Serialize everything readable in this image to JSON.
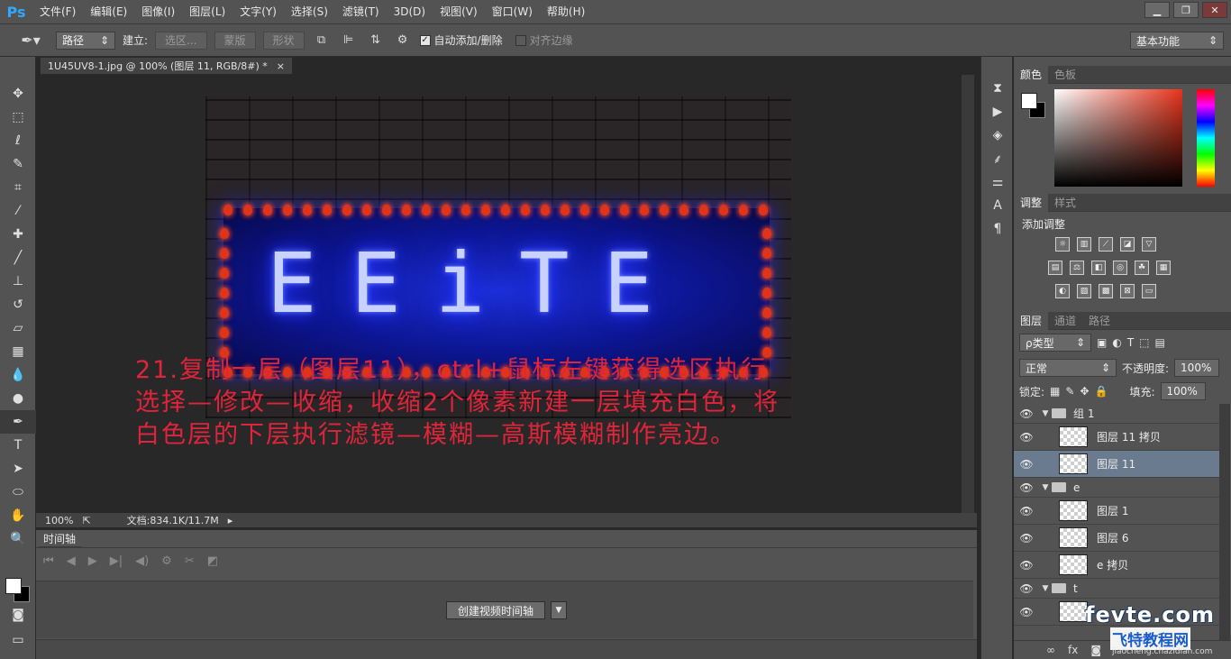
{
  "app": {
    "logo": "Ps",
    "menu": [
      "文件(F)",
      "编辑(E)",
      "图像(I)",
      "图层(L)",
      "文字(Y)",
      "选择(S)",
      "滤镜(T)",
      "3D(D)",
      "视图(V)",
      "窗口(W)",
      "帮助(H)"
    ],
    "window_buttons": [
      "▁",
      "❐",
      "✕"
    ]
  },
  "options": {
    "mode_select": "路径",
    "build_label": "建立:",
    "btn_selection": "选区...",
    "btn_mask": "蒙版",
    "btn_shape": "形状",
    "auto_add_delete": "自动添加/删除",
    "align_edges": "对齐边缘",
    "workspace": "基本功能"
  },
  "document": {
    "tab_title": "1U45UV8-1.jpg @ 100% (图层 11, RGB/8#) *",
    "tab_close": "×",
    "zoom": "100%",
    "doc_size": "文档:834.1K/11.7M",
    "neon_text": "EEiTE",
    "overlay_lines": [
      "21.复制一层（图层11），ctrl+鼠标左键获得选区执行",
      "选择—修改—收缩，收缩2个像素新建一层填充白色，将",
      "白色层的下层执行滤镜—模糊—高斯模糊制作亮边。"
    ]
  },
  "timeline": {
    "tab": "时间轴",
    "create_button": "创建视频时间轴"
  },
  "color_panel": {
    "tabs": [
      "颜色",
      "色板"
    ],
    "accent": "#e8341c"
  },
  "adjust_panel": {
    "tabs": [
      "调整",
      "样式"
    ],
    "title": "添加调整"
  },
  "layers_panel": {
    "tabs": [
      "图层",
      "通道",
      "路径"
    ],
    "filter_label": "ρ类型",
    "blend_mode": "正常",
    "opacity_label": "不透明度:",
    "opacity_value": "100%",
    "lock_label": "锁定:",
    "fill_label": "填充:",
    "fill_value": "100%",
    "layers": [
      {
        "name": "组 1",
        "type": "group",
        "selected": false
      },
      {
        "name": "图层 11 拷贝",
        "type": "layer",
        "selected": false
      },
      {
        "name": "图层 11",
        "type": "layer",
        "selected": true
      },
      {
        "name": "e",
        "type": "group",
        "selected": false
      },
      {
        "name": "图层 1",
        "type": "layer",
        "selected": false
      },
      {
        "name": "图层 6",
        "type": "layer",
        "selected": false
      },
      {
        "name": "e 拷贝",
        "type": "layer",
        "selected": false
      },
      {
        "name": "t",
        "type": "group",
        "selected": false
      },
      {
        "name": "",
        "type": "layer",
        "selected": false
      }
    ],
    "footer_icons": [
      "link-icon",
      "fx-icon",
      "mask-icon"
    ]
  },
  "watermark": {
    "brand": "fevte.com",
    "cn": "飞特教程网",
    "url": "jiaocheng.chazidian.com"
  }
}
